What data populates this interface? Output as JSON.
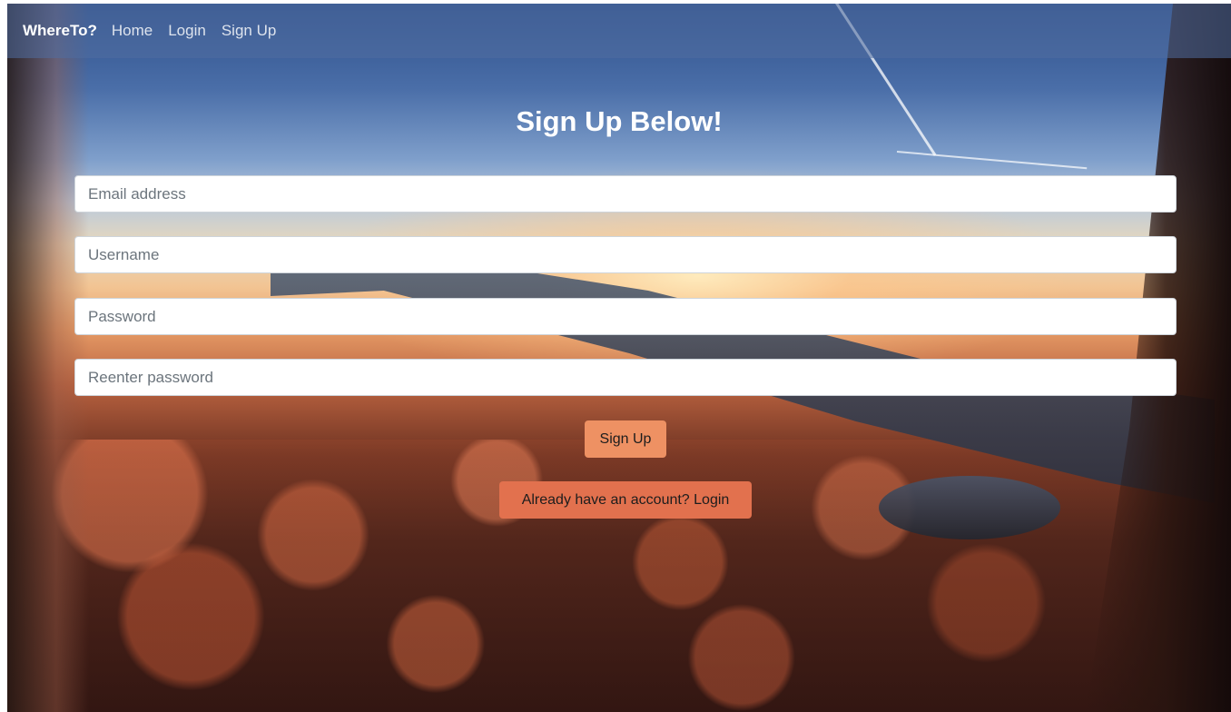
{
  "navbar": {
    "brand": "WhereTo?",
    "links": [
      {
        "label": "Home"
      },
      {
        "label": "Login"
      },
      {
        "label": "Sign Up"
      }
    ]
  },
  "form": {
    "title": "Sign Up Below!",
    "fields": {
      "email": {
        "placeholder": "Email address",
        "value": ""
      },
      "username": {
        "placeholder": "Username",
        "value": ""
      },
      "password": {
        "placeholder": "Password",
        "value": ""
      },
      "reenter_password": {
        "placeholder": "Reenter password",
        "value": ""
      }
    },
    "submit_label": "Sign Up",
    "login_label": "Already have an account? Login"
  },
  "colors": {
    "signup_button": "#ee9163",
    "login_button": "#e2714e",
    "navbar": "#506ea0"
  }
}
